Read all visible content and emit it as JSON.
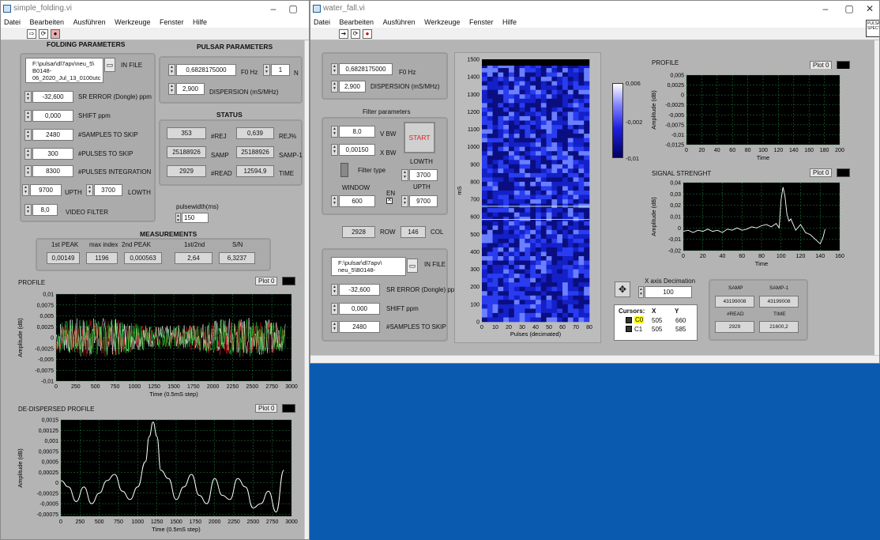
{
  "left_window": {
    "title": "simple_folding.vi",
    "menu": [
      "Datei",
      "Bearbeiten",
      "Ausführen",
      "Werkzeuge",
      "Fenster",
      "Hilfe"
    ],
    "folding": {
      "header": "FOLDING PARAMETERS",
      "in_file_label": "IN FILE",
      "in_file_value": "F:\\pulsar\\dl7apv\\neu_5\\ B0148- 06_2020_Jul_13_0100utc",
      "sr_error_value": "-32,600",
      "sr_error_label": "SR ERROR (Dongle) ppm",
      "shift_value": "0,000",
      "shift_label": "SHIFT ppm",
      "samples_skip_value": "2480",
      "samples_skip_label": "#SAMPLES TO SKIP",
      "pulses_skip_value": "300",
      "pulses_skip_label": "#PULSES TO SKIP",
      "pulses_int_value": "8300",
      "pulses_int_label": "#PULSES INTEGRATION",
      "upth_value": "9700",
      "upth_label": "UPTH",
      "lowth_value": "3700",
      "lowth_label": "LOWTH",
      "video_value": "8,0",
      "video_label": "VIDEO FILTER"
    },
    "pulsar": {
      "header": "PULSAR PARAMETERS",
      "f0_value": "0,6828175000",
      "f0_label": "F0 Hz",
      "n_value": "1",
      "n_label": "N",
      "dm_value": "2,900",
      "dm_label": "DISPERSION (mS/MHz)"
    },
    "status": {
      "header": "STATUS",
      "rej_value": "353",
      "rej_label": "#REJ",
      "rejpct_value": "0,639",
      "rejpct_label": "REJ%",
      "samp_value": "25188926",
      "samp_label": "SAMP",
      "samp1_value": "25188926",
      "samp1_label": "SAMP-1",
      "read_value": "2929",
      "read_label": "#READ",
      "time_value": "12594,9",
      "time_label": "TIME"
    },
    "pulsewidth_label": "pulsewidth(ms)",
    "pulsewidth_value": "150",
    "measurements": {
      "header": "MEASUREMENTS",
      "cols": [
        "1st PEAK",
        "max index",
        "2nd PEAK",
        "1st/2nd",
        "S/N"
      ],
      "values": [
        "0,00149",
        "1196",
        "0,000563",
        "2,64",
        "6,3237"
      ]
    },
    "profile_title": "PROFILE",
    "dedisp_title": "DE-DISPERSED PROFILE",
    "plot_legend": "Plot 0"
  },
  "right_window": {
    "title": "water_fall.vi",
    "menu": [
      "Datei",
      "Bearbeiten",
      "Ausführen",
      "Werkzeuge",
      "Fenster",
      "Hilfe"
    ],
    "corner_label": "PULSAR SPECT",
    "f0_value": "0,6828175000",
    "f0_label": "F0 Hz",
    "dm_value": "2,900",
    "dm_label": "DISPERSION (mS/MHz)",
    "filter": {
      "header": "Filter parameters",
      "vbw_value": "8,0",
      "vbw_label": "V BW",
      "xbw_value": "0,00150",
      "xbw_label": "X BW",
      "filter_type_label": "Filter type",
      "start_label": "START",
      "lowth_label": "LOWTH",
      "lowth_value": "3700",
      "window_label": "WINDOW",
      "window_value": "600",
      "en_label": "EN",
      "upth_label": "UPTH",
      "upth_value": "9700"
    },
    "row_value": "2928",
    "row_label": "ROW",
    "col_value": "146",
    "col_label": "COL",
    "in_file_label": "IN FILE",
    "in_file_value": "F:\\pulsar\\dl7apv\\ neu_5\\B0148-",
    "sr_error_value": "-32,600",
    "sr_error_label": "SR ERROR (Dongle) ppm",
    "shift_value": "0,000",
    "shift_label": "SHIFT ppm",
    "samples_skip_value": "2480",
    "samples_skip_label": "#SAMPLES TO SKIP",
    "colorbar_ticks": [
      "0,006",
      "-0,002",
      "-0,01"
    ],
    "profile_title": "PROFILE",
    "signal_title": "SIGNAL STRENGHT",
    "plot_legend": "Plot 0",
    "xdec_label": "X axis Decimation",
    "xdec_value": "100",
    "cursors": {
      "headers": [
        "Cursors:",
        "X",
        "Y"
      ],
      "rows": [
        [
          "C0",
          "505",
          "660"
        ],
        [
          "C1",
          "505",
          "585"
        ]
      ]
    },
    "stats": {
      "samp_label": "SAMP",
      "samp_value": "43199008",
      "samp1_label": "SAMP-1",
      "samp1_value": "43199008",
      "read_label": "#READ",
      "read_value": "2929",
      "time_label": "TIME",
      "time_value": "21600,2"
    }
  },
  "chart_data": [
    {
      "type": "line",
      "title": "PROFILE",
      "xlabel": "Time (0.5mS step)",
      "ylabel": "Amplitude (dB)",
      "xlim": [
        0,
        3000
      ],
      "ylim": [
        -0.01,
        0.01
      ],
      "xticks": [
        0,
        250,
        500,
        750,
        1000,
        1250,
        1500,
        1750,
        2000,
        2250,
        2500,
        2750,
        3000
      ],
      "yticks": [
        "0,01",
        "0,0075",
        "0,005",
        "0,0025",
        "0",
        "-0,0025",
        "-0,005",
        "-0,0075",
        "-0,01"
      ],
      "series": [
        {
          "name": "Plot 0",
          "note_color": "#ffffff"
        }
      ],
      "colors": [
        "#ffffff",
        "#ff2020",
        "#20ff40"
      ]
    },
    {
      "type": "line",
      "title": "DE-DISPERSED PROFILE",
      "xlabel": "Time (0.5mS step)",
      "ylabel": "Amplitude (dB)",
      "xlim": [
        0,
        3000
      ],
      "ylim": [
        -0.0008,
        0.0015
      ],
      "xticks": [
        0,
        250,
        500,
        750,
        1000,
        1250,
        1500,
        1750,
        2000,
        2250,
        2500,
        2750,
        3000
      ],
      "yticks": [
        "0,0015",
        "0,00125",
        "0,001",
        "0,00075",
        "0,0005",
        "0,00025",
        "0",
        "-0,00025",
        "-0,0005",
        "-0,00075"
      ],
      "series": [
        {
          "name": "Plot 0",
          "x": [
            0,
            100,
            200,
            300,
            400,
            500,
            600,
            700,
            800,
            900,
            1000,
            1100,
            1150,
            1200,
            1250,
            1300,
            1400,
            1500,
            1600,
            1700,
            1800,
            1900,
            2000,
            2100,
            2200,
            2300,
            2400,
            2500,
            2600,
            2700,
            2800,
            2900
          ],
          "y": [
            5e-05,
            -0.0001,
            -0.00045,
            -0.0001,
            -0.0005,
            -0.00025,
            5e-05,
            0.0002,
            -0.0002,
            -0.0004,
            -0.0001,
            0.0005,
            0.0011,
            0.00145,
            0.0011,
            0.0003,
            0.0001,
            -0.0004,
            -0.0001,
            0.0002,
            -0.0003,
            -0.0005,
            0.0001,
            -0.0003,
            -0.0004,
            0.0001,
            -0.0001,
            -0.0006,
            -0.0005,
            -0.0002,
            -0.0007,
            0.0003
          ]
        }
      ]
    },
    {
      "type": "heatmap",
      "xlabel": "Pulses (decimated)",
      "ylabel": "mS",
      "xlim": [
        0,
        80
      ],
      "ylim": [
        0,
        1500
      ],
      "xticks": [
        0,
        10,
        20,
        30,
        40,
        50,
        60,
        70,
        80
      ],
      "yticks": [
        0,
        100,
        200,
        300,
        400,
        500,
        600,
        700,
        800,
        900,
        1000,
        1100,
        1200,
        1300,
        1400,
        1500
      ],
      "cursor_lines_y": [
        660,
        585
      ],
      "color_range": [
        -0.01,
        0.006
      ]
    },
    {
      "type": "line",
      "title": "PROFILE",
      "xlabel": "Time",
      "ylabel": "Amplitude (dB)",
      "xlim": [
        0,
        200
      ],
      "ylim": [
        -0.0125,
        0.005
      ],
      "xticks": [
        0,
        20,
        40,
        60,
        80,
        100,
        120,
        140,
        160,
        180,
        200
      ],
      "yticks": [
        "0,005",
        "0,0025",
        "0",
        "-0,0025",
        "-0,005",
        "-0,0075",
        "-0,01",
        "-0,0125"
      ],
      "series": [
        {
          "name": "Plot 0",
          "x": [],
          "y": []
        }
      ]
    },
    {
      "type": "line",
      "title": "SIGNAL STRENGHT",
      "xlabel": "Time",
      "ylabel": "Amplitude (dB)",
      "xlim": [
        0,
        160
      ],
      "ylim": [
        -0.02,
        0.04
      ],
      "xticks": [
        0,
        20,
        40,
        60,
        80,
        100,
        120,
        140,
        160
      ],
      "yticks": [
        "0,04",
        "0,03",
        "0,02",
        "0,01",
        "0",
        "-0,01",
        "-0,02"
      ],
      "series": [
        {
          "name": "Plot 0",
          "x": [
            0,
            5,
            10,
            15,
            20,
            25,
            30,
            35,
            40,
            45,
            50,
            55,
            60,
            65,
            70,
            75,
            80,
            85,
            90,
            95,
            98,
            100,
            102,
            104,
            106,
            108,
            110,
            115,
            120,
            125,
            130,
            135,
            140,
            143,
            145
          ],
          "y": [
            -0.003,
            -0.002,
            -0.004,
            -0.002,
            -0.003,
            -0.001,
            -0.003,
            -0.002,
            -0.004,
            -0.001,
            -0.002,
            0,
            -0.002,
            -0.001,
            0.001,
            0.0,
            0.002,
            0.003,
            0.001,
            0.004,
            0.0,
            0.025,
            0.036,
            0.028,
            0.012,
            0.006,
            0.008,
            -0.002,
            0.003,
            -0.004,
            -0.006,
            -0.01,
            -0.014,
            -0.008,
            -0.001
          ]
        }
      ]
    }
  ]
}
